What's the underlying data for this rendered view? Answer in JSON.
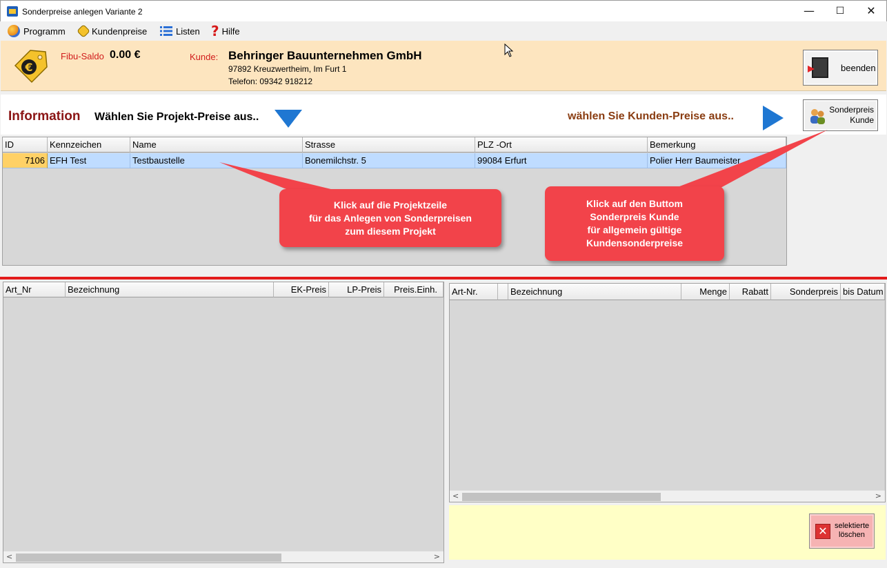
{
  "window": {
    "title": "Sonderpreise anlegen Variante 2",
    "min": "—",
    "max": "☐",
    "close": "✕"
  },
  "menu": [
    {
      "label": "Programm",
      "icon": "program-icon"
    },
    {
      "label": "Kundenpreise",
      "icon": "euro-tag-icon"
    },
    {
      "label": "Listen",
      "icon": "list-icon"
    },
    {
      "label": "Hilfe",
      "icon": "help-icon"
    }
  ],
  "header": {
    "fibu_label": "Fibu-Saldo",
    "fibu_value": "0.00 €",
    "kunde_label": "Kunde:",
    "kunde_name": "Behringer Bauunternehmen GmbH",
    "kunde_address": "97892 Kreuzwertheim,  Im Furt 1",
    "kunde_phone": "Telefon:  09342 918212",
    "exit_button": "beenden"
  },
  "info": {
    "title": "Information",
    "projekt_prompt": "Wählen Sie Projekt-Preise aus..",
    "kunden_prompt": "wählen Sie Kunden-Preise aus..",
    "sonder_button_line1": "Sonderpreis",
    "sonder_button_line2": "Kunde"
  },
  "project_grid": {
    "columns": [
      "ID",
      "Kennzeichen",
      "Name",
      "Strasse",
      "PLZ -Ort",
      "Bemerkung"
    ],
    "rows": [
      [
        "7106",
        "EFH Test",
        "Testbaustelle",
        "Bonemilchstr. 5",
        "99084 Erfurt",
        "Polier Herr Baumeister"
      ]
    ]
  },
  "article_grid": {
    "columns": [
      "Art_Nr",
      "Bezeichnung",
      "EK-Preis",
      "LP-Preis",
      "Preis.Einh."
    ]
  },
  "special_price_grid": {
    "columns": [
      "Art-Nr.",
      "",
      "Bezeichnung",
      "Menge",
      "Rabatt",
      "Sonderpreis",
      "bis Datum"
    ]
  },
  "delete_button": {
    "line1": "selektierte",
    "line2": "löschen"
  },
  "callouts": {
    "project": [
      "Klick auf die Projektzeile",
      "für das Anlegen von Sonderpreisen",
      "zum diesem Projekt"
    ],
    "customer": [
      "Klick auf den Buttom",
      "Sonderpreis Kunde",
      "für allgemein gültige",
      "Kundensonderpreise"
    ]
  },
  "colors": {
    "header_bg": "#fde5bf",
    "accent_red": "#e31b1b",
    "callout": "#f2434a",
    "row_selected": "#bfdcff",
    "id_cell": "#ffd166",
    "arrow_blue": "#1f77d2"
  }
}
